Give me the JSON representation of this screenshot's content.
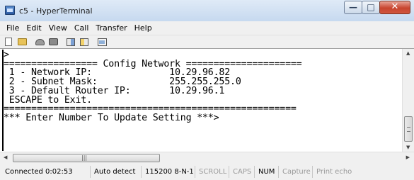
{
  "window": {
    "title": "c5 - HyperTerminal",
    "caption": {
      "minimize": "—",
      "maximize": "□",
      "close": "✕"
    }
  },
  "menu": {
    "items": [
      "File",
      "Edit",
      "View",
      "Call",
      "Transfer",
      "Help"
    ]
  },
  "toolbar": {
    "icons": [
      "new-connection-icon",
      "open-icon",
      "call-icon",
      "disconnect-icon",
      "send-file-icon",
      "receive-file-icon",
      "properties-icon"
    ]
  },
  "terminal": {
    "lines": [
      ">",
      "================= Config Network =====================",
      " 1 - Network IP:              10.29.96.82",
      " 2 - Subnet Mask:             255.255.255.0",
      " 3 - Default Router IP:       10.29.96.1",
      " ESCAPE to Exit.",
      "=====================================================",
      "*** Enter Number To Update Setting ***>"
    ]
  },
  "statusbar": {
    "connected": "Connected 0:02:53",
    "detect": "Auto detect",
    "settings": "115200 8-N-1",
    "scroll": "SCROLL",
    "caps": "CAPS",
    "num": "NUM",
    "capture": "Capture",
    "print_echo": "Print echo"
  },
  "scroll_glyphs": {
    "up": "▲",
    "down": "▼",
    "left": "◀",
    "right": "▶",
    "grip": "|||"
  }
}
